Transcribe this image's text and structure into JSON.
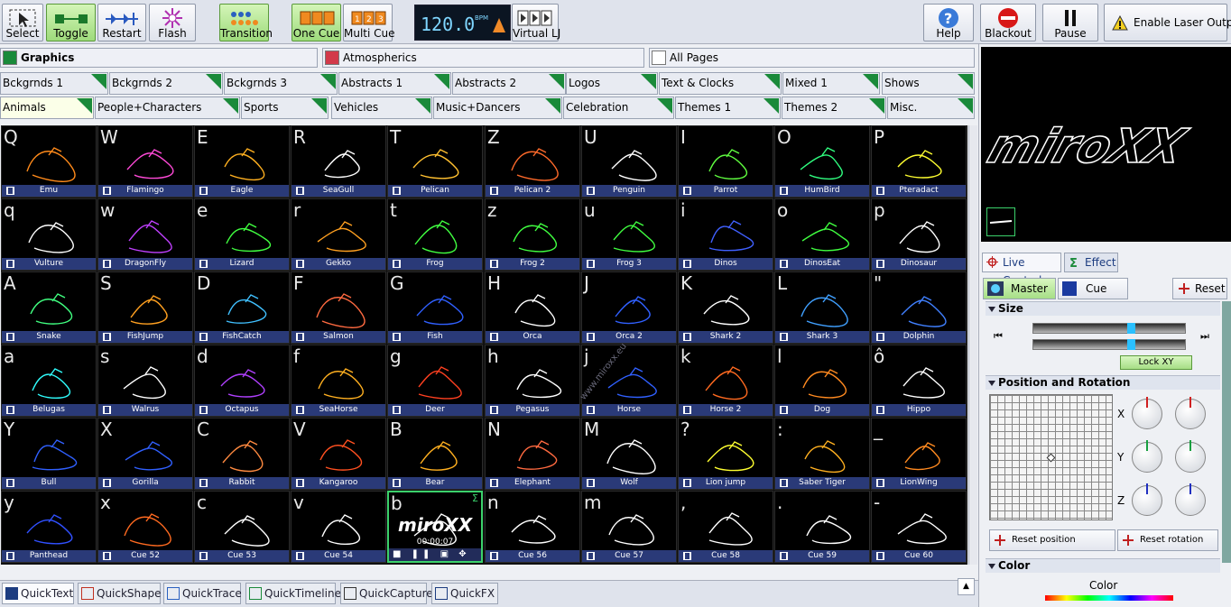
{
  "toolbar": {
    "select": "Select",
    "toggle": "Toggle",
    "restart": "Restart",
    "flash": "Flash",
    "transition": "Transition",
    "one_cue": "One Cue",
    "multi_cue": "Multi Cue",
    "bpm_value": "120.0",
    "bpm_unit": "BPM",
    "virtual_lj": "Virtual LJ",
    "help": "Help",
    "blackout": "Blackout",
    "pause": "Pause",
    "enable_laser": "Enable Laser Output",
    "multi_digits": [
      "1",
      "2",
      "3"
    ]
  },
  "pages": [
    {
      "label": "Graphics",
      "color": "#1a8a3a"
    },
    {
      "label": "Atmospherics",
      "color": "#d23a4a"
    },
    {
      "label": "All Pages",
      "color": "#ffffff"
    }
  ],
  "tabs_row1": [
    "Bckgrnds 1",
    "Bckgrnds 2",
    "Bckgrnds 3",
    "Abstracts 1",
    "Abstracts 2",
    "Logos",
    "Text & Clocks",
    "Mixed 1",
    "Shows"
  ],
  "tabs_row2": [
    "Animals",
    "People+Characters",
    "Sports",
    "Vehicles",
    "Music+Dancers",
    "Celebration",
    "Themes 1",
    "Themes 2",
    "Misc."
  ],
  "cells": [
    {
      "key": "Q",
      "name": "Emu",
      "color": "#ff8a1a"
    },
    {
      "key": "W",
      "name": "Flamingo",
      "color": "#ff4ad8"
    },
    {
      "key": "E",
      "name": "Eagle",
      "color": "#ffb020"
    },
    {
      "key": "R",
      "name": "SeaGull",
      "color": "#ffffff"
    },
    {
      "key": "T",
      "name": "Pelican",
      "color": "#ffc030"
    },
    {
      "key": "Z",
      "name": "Pelican 2",
      "color": "#ff6a2a"
    },
    {
      "key": "U",
      "name": "Penguin",
      "color": "#ffffff"
    },
    {
      "key": "I",
      "name": "Parrot",
      "color": "#60ff40"
    },
    {
      "key": "O",
      "name": "HumBird",
      "color": "#30ff80"
    },
    {
      "key": "P",
      "name": "Pteradact",
      "color": "#ffff30"
    },
    {
      "key": "q",
      "name": "Vulture",
      "color": "#ffffff"
    },
    {
      "key": "w",
      "name": "DragonFly",
      "color": "#c040ff"
    },
    {
      "key": "e",
      "name": "Lizard",
      "color": "#40ff40"
    },
    {
      "key": "r",
      "name": "Gekko",
      "color": "#ffa020"
    },
    {
      "key": "t",
      "name": "Frog",
      "color": "#40ff40"
    },
    {
      "key": "z",
      "name": "Frog 2",
      "color": "#40ff40"
    },
    {
      "key": "u",
      "name": "Frog 3",
      "color": "#40ff40"
    },
    {
      "key": "i",
      "name": "Dinos",
      "color": "#4060ff"
    },
    {
      "key": "o",
      "name": "DinosEat",
      "color": "#40ff40"
    },
    {
      "key": "p",
      "name": "Dinosaur",
      "color": "#ffffff"
    },
    {
      "key": "A",
      "name": "Snake",
      "color": "#40ff80"
    },
    {
      "key": "S",
      "name": "FishJump",
      "color": "#ffa020"
    },
    {
      "key": "D",
      "name": "FishCatch",
      "color": "#40c0ff"
    },
    {
      "key": "F",
      "name": "Salmon",
      "color": "#ff6a40"
    },
    {
      "key": "G",
      "name": "Fish",
      "color": "#3060ff"
    },
    {
      "key": "H",
      "name": "Orca",
      "color": "#ffffff"
    },
    {
      "key": "J",
      "name": "Orca 2",
      "color": "#3060ff"
    },
    {
      "key": "K",
      "name": "Shark 2",
      "color": "#ffffff"
    },
    {
      "key": "L",
      "name": "Shark 3",
      "color": "#40a0ff"
    },
    {
      "key": "\"",
      "name": "Dolphin",
      "color": "#4080ff"
    },
    {
      "key": "a",
      "name": "Belugas",
      "color": "#30ffff"
    },
    {
      "key": "s",
      "name": "Walrus",
      "color": "#ffffff"
    },
    {
      "key": "d",
      "name": "Octapus",
      "color": "#b040ff"
    },
    {
      "key": "f",
      "name": "SeaHorse",
      "color": "#ffb020"
    },
    {
      "key": "g",
      "name": "Deer",
      "color": "#ff4020"
    },
    {
      "key": "h",
      "name": "Pegasus",
      "color": "#ffffff"
    },
    {
      "key": "j",
      "name": "Horse",
      "color": "#3060ff"
    },
    {
      "key": "k",
      "name": "Horse 2",
      "color": "#ff6a20"
    },
    {
      "key": "l",
      "name": "Dog",
      "color": "#ff8a20"
    },
    {
      "key": "ô",
      "name": "Hippo",
      "color": "#ffffff"
    },
    {
      "key": "Y",
      "name": "Bull",
      "color": "#3060ff"
    },
    {
      "key": "X",
      "name": "Gorilla",
      "color": "#3060ff"
    },
    {
      "key": "C",
      "name": "Rabbit",
      "color": "#ff8a40"
    },
    {
      "key": "V",
      "name": "Kangaroo",
      "color": "#ff5020"
    },
    {
      "key": "B",
      "name": "Bear",
      "color": "#ffb020"
    },
    {
      "key": "N",
      "name": "Elephant",
      "color": "#ff6a40"
    },
    {
      "key": "M",
      "name": "Wolf",
      "color": "#ffffff"
    },
    {
      "key": "?",
      "name": "Lion jump",
      "color": "#ffff30"
    },
    {
      "key": ":",
      "name": "Saber Tiger",
      "color": "#ffb020"
    },
    {
      "key": "_",
      "name": "LionWing",
      "color": "#ff8a20"
    },
    {
      "key": "y",
      "name": "Panthead",
      "color": "#3050ff"
    },
    {
      "key": "x",
      "name": "Cue 52",
      "color": "#ff6a20"
    },
    {
      "key": "c",
      "name": "Cue 53",
      "color": "#ffffff"
    },
    {
      "key": "v",
      "name": "Cue 54",
      "color": "#ffffff"
    },
    {
      "key": "b",
      "name": "",
      "color": "#ffffff"
    },
    {
      "key": "n",
      "name": "Cue 56",
      "color": "#ffffff"
    },
    {
      "key": "m",
      "name": "Cue 57",
      "color": "#ffffff"
    },
    {
      "key": ",",
      "name": "Cue 58",
      "color": "#ffffff"
    },
    {
      "key": ".",
      "name": "Cue 59",
      "color": "#ffffff"
    },
    {
      "key": "-",
      "name": "Cue 60",
      "color": "#ffffff"
    }
  ],
  "active_cue": {
    "logo": "miroXX",
    "time": "00:00:07"
  },
  "watermark": "www.miroxx.eu",
  "bottom_tabs": [
    "QuickText",
    "QuickShape",
    "QuickTrace",
    "QuickTimeline",
    "QuickCapture",
    "QuickFX"
  ],
  "preview_logo": "miroXX",
  "right": {
    "tab_live": "Live Control",
    "tab_effect": "Effect",
    "master": "Master",
    "cue": "Cue",
    "reset": "Reset",
    "size_section": "Size",
    "lock_xy": "Lock XY",
    "pos_section": "Position and Rotation",
    "axis_x": "X",
    "axis_y": "Y",
    "axis_z": "Z",
    "reset_position": "Reset position",
    "reset_rotation": "Reset rotation",
    "color_section": "Color",
    "color_label": "Color"
  }
}
